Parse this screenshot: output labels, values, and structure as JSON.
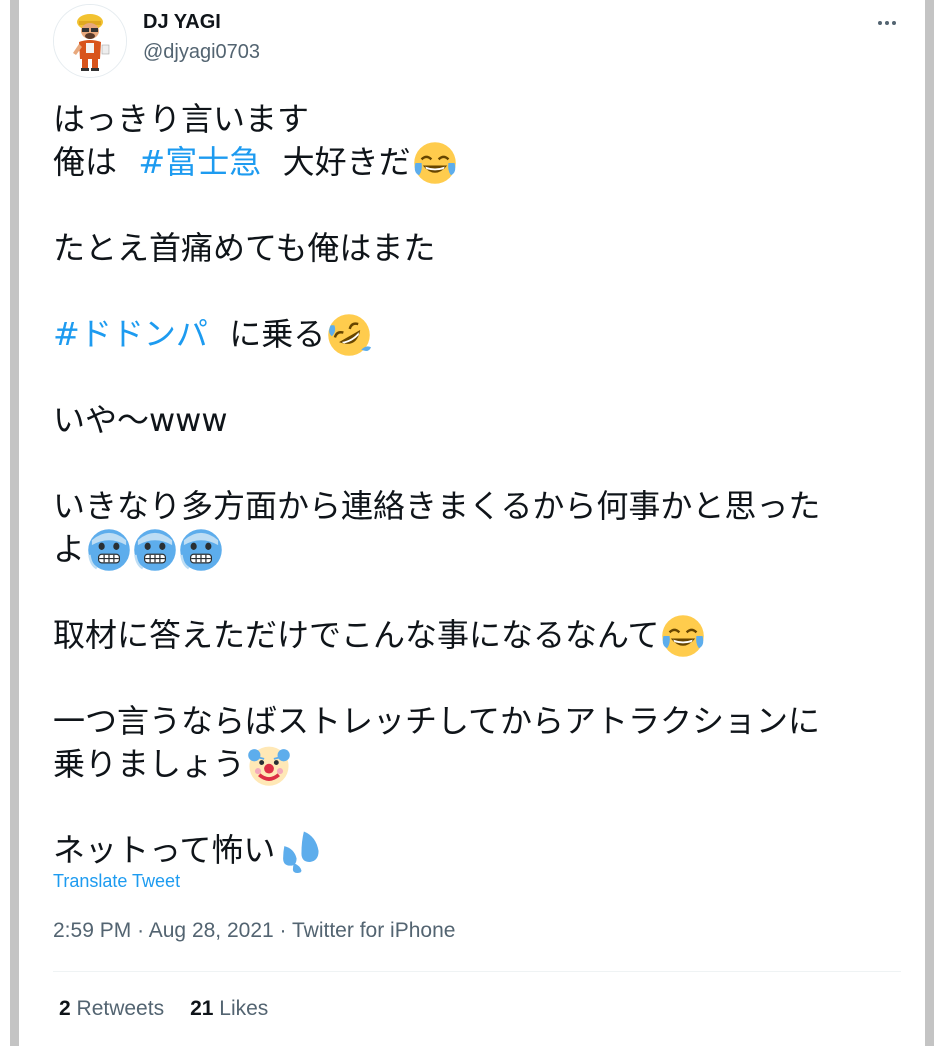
{
  "author": {
    "display_name": "DJ YAGI",
    "handle": "@djyagi0703"
  },
  "tweet": {
    "lines": [
      {
        "parts": [
          {
            "text": "はっきり言います"
          }
        ]
      },
      {
        "parts": [
          {
            "text": "俺は "
          },
          {
            "text": "#富士急",
            "hashtag": true
          },
          {
            "text": " 大好きだ"
          }
        ],
        "emoji": "face-with-tears-of-joy"
      },
      {
        "blank": true
      },
      {
        "parts": [
          {
            "text": "たとえ首痛めても俺はまた"
          }
        ]
      },
      {
        "blank": true
      },
      {
        "parts": [
          {
            "text": "#ドドンパ",
            "hashtag": true
          },
          {
            "text": " に乗る"
          }
        ],
        "emoji": "rolling-on-floor-laughing"
      },
      {
        "blank": true
      },
      {
        "parts": [
          {
            "text": "いや〜www"
          }
        ]
      },
      {
        "blank": true
      },
      {
        "parts": [
          {
            "text": "いきなり多方面から連絡きまくるから何事かと思った"
          }
        ]
      },
      {
        "parts": [
          {
            "text": "よ"
          }
        ],
        "emoji": "cold-face",
        "emoji_count": 3
      },
      {
        "blank": true
      },
      {
        "parts": [
          {
            "text": "取材に答えただけでこんな事になるなんて"
          }
        ],
        "emoji": "face-with-tears-of-joy"
      },
      {
        "blank": true
      },
      {
        "parts": [
          {
            "text": "一つ言うならばストレッチしてからアトラクションに"
          }
        ]
      },
      {
        "parts": [
          {
            "text": "乗りましょう"
          }
        ],
        "emoji": "clown-face"
      },
      {
        "blank": true
      },
      {
        "parts": [
          {
            "text": "ネットって怖い"
          }
        ],
        "emoji": "sweat-droplets"
      }
    ],
    "translate_label": "Translate Tweet",
    "time": "2:59 PM",
    "date": "Aug 28, 2021",
    "source": "Twitter for iPhone",
    "separator": "·"
  },
  "stats": {
    "retweets_count": "2",
    "retweets_label": "Retweets",
    "likes_count": "21",
    "likes_label": "Likes"
  },
  "icons": {
    "more": "more-horizontal-icon"
  },
  "colors": {
    "link": "#1d9bf0",
    "text": "#0f1419",
    "secondary": "#536471"
  }
}
